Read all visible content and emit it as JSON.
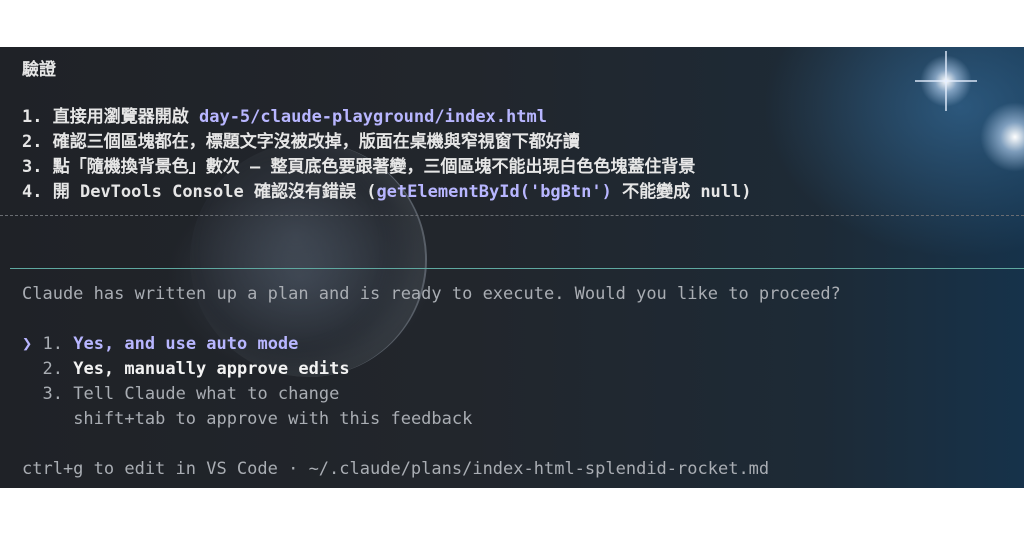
{
  "plan": {
    "title": "驗證",
    "steps": [
      {
        "num": "1.",
        "text": "直接用瀏覽器開啟",
        "path": "day-5/claude-playground/index.html"
      },
      {
        "num": "2.",
        "text": "確認三個區塊都在，標題文字沒被改掉，版面在桌機與窄視窗下都好讀"
      },
      {
        "num": "3.",
        "text": "點「隨機換背景色」數次 — 整頁底色要跟著變，三個區塊不能出現白色色塊蓋住背景"
      },
      {
        "num": "4.",
        "text_before": "開 DevTools Console 確認沒有錯誤 (",
        "code": "getElementById('bgBtn')",
        "text_after": " 不能變成 null)"
      }
    ]
  },
  "prompt": {
    "question": "Claude has written up a plan and is ready to execute. Would you like to proceed?",
    "selector": "❯",
    "options": [
      {
        "num": "1.",
        "label": "Yes, and use auto mode"
      },
      {
        "num": "2.",
        "label": "Yes, manually approve edits"
      },
      {
        "num": "3.",
        "label": "Tell Claude what to change"
      }
    ],
    "hint": "shift+tab to approve with this feedback",
    "footer": "ctrl+g to edit in VS Code · ~/.claude/plans/index-html-splendid-rocket.md"
  },
  "colors": {
    "accent": "#b8b6ff",
    "separator": "#5fa8a0",
    "text": "#e6e6e6",
    "muted": "#a9adb3"
  }
}
